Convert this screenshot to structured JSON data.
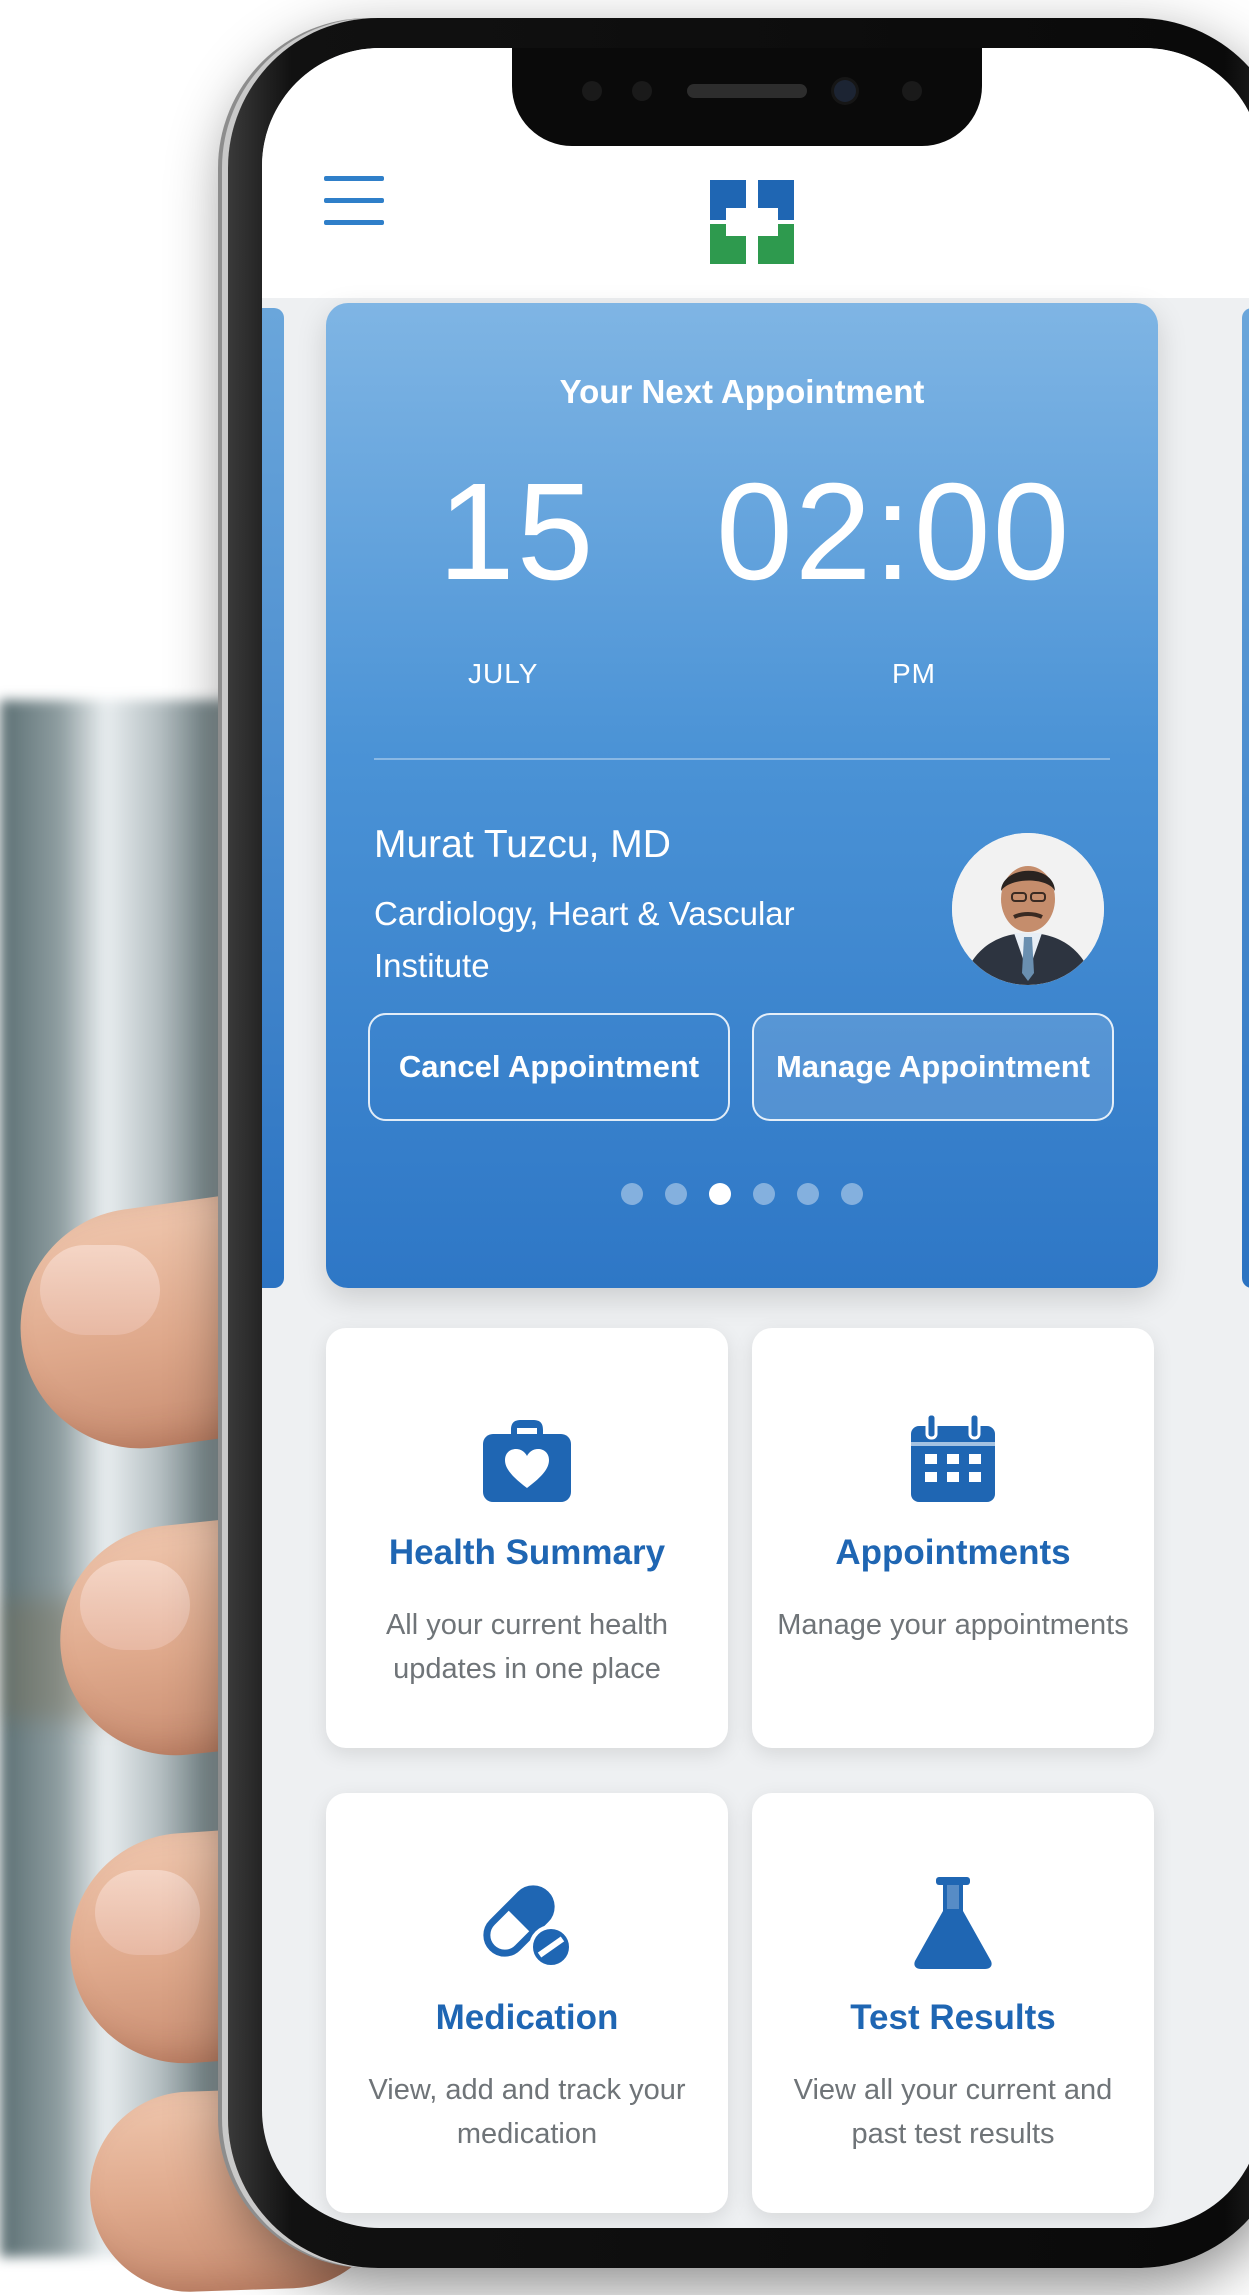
{
  "header": {
    "menu_icon": "hamburger-menu-icon",
    "logo_icon": "cross-logo-icon"
  },
  "appointment": {
    "heading": "Your Next Appointment",
    "day": "15",
    "month": "JULY",
    "time": "02:00",
    "meridiem": "PM",
    "doctor_name": "Murat Tuzcu, MD",
    "department": "Cardiology, Heart & Vascular Institute",
    "cancel_label": "Cancel Appointment",
    "manage_label": "Manage Appointment",
    "carousel_total": 6,
    "carousel_active_index": 3
  },
  "tiles": [
    {
      "icon": "medical-bag-heart-icon",
      "title": "Health Summary",
      "description": "All your current health updates in one place"
    },
    {
      "icon": "calendar-icon",
      "title": "Appointments",
      "description": "Manage your appointments"
    },
    {
      "icon": "pill-capsule-icon",
      "title": "Medication",
      "description": "View, add and track your medication"
    },
    {
      "icon": "lab-flask-icon",
      "title": "Test Results",
      "description": "View all your current and past test results"
    }
  ],
  "colors": {
    "accent": "#1f66b3",
    "card_top": "#7fb5e4",
    "card_bottom": "#2e77c6",
    "logo_blue": "#1f66b3",
    "logo_green": "#2e9a4e"
  }
}
